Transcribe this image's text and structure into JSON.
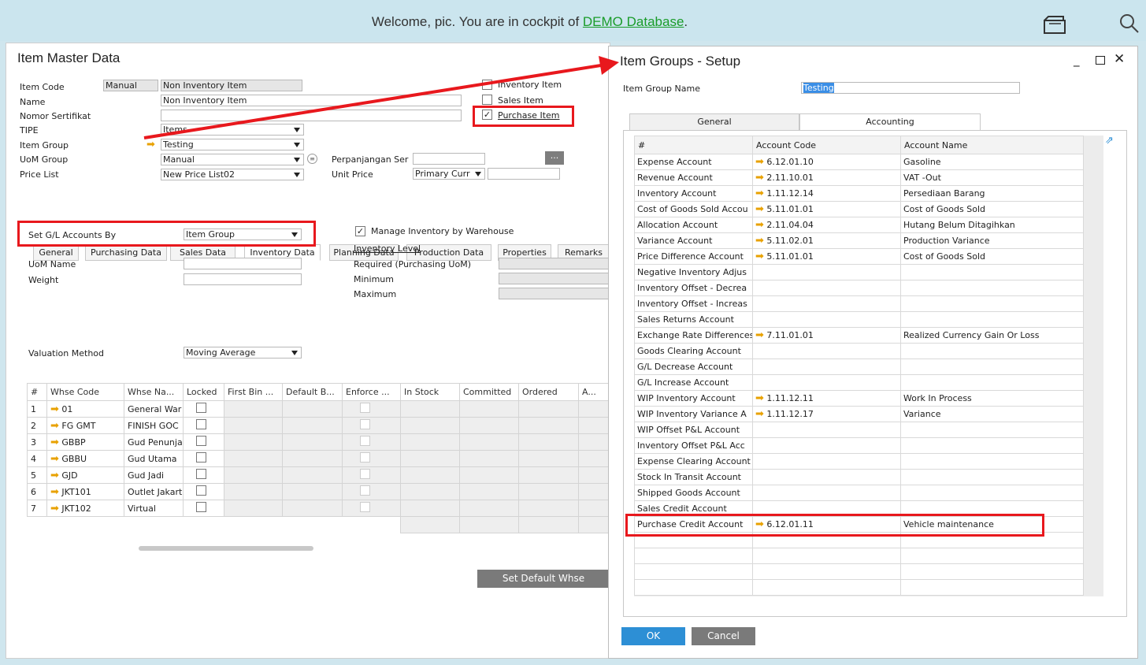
{
  "topbar": {
    "welcome_prefix": "Welcome, pic. You are in cockpit of ",
    "db_link": "DEMO Database",
    "suffix": "."
  },
  "imd": {
    "title": "Item Master Data",
    "labels": {
      "item_code": "Item Code",
      "name": "Name",
      "nomor": "Nomor Sertifikat",
      "tipe": "TIPE",
      "item_group": "Item Group",
      "uom_group": "UoM Group",
      "price_list": "Price List",
      "perpanjangan": "Perpanjangan Ser",
      "unit_price": "Unit Price"
    },
    "values": {
      "code_mode": "Manual",
      "item_code": "Non Inventory Item",
      "name": "Non Inventory Item",
      "nomor": "",
      "tipe": "Items",
      "item_group": "Testing",
      "uom_group": "Manual",
      "price_list": "New Price List02",
      "currency": "Primary Curr"
    },
    "checks": {
      "inventory": "Inventory Item",
      "sales": "Sales Item",
      "purchase": "Purchase Item"
    },
    "browse": "...",
    "tabs": [
      "General",
      "Purchasing Data",
      "Sales Data",
      "Inventory Data",
      "Planning Data",
      "Production Data",
      "Properties",
      "Remarks"
    ],
    "inv": {
      "gl_label": "Set G/L Accounts By",
      "gl_value": "Item Group",
      "manage": "Manage Inventory by Warehouse",
      "uom_name": "UoM Name",
      "weight": "Weight",
      "inv_level": "Inventory Level",
      "required": "Required (Purchasing UoM)",
      "minimum": "Minimum",
      "maximum": "Maximum",
      "valuation_label": "Valuation Method",
      "valuation": "Moving Average"
    },
    "wh_headers": [
      "#",
      "Whse Code",
      "Whse Na...",
      "Locked",
      "First Bin ...",
      "Default B...",
      "Enforce ...",
      "In Stock",
      "Committed",
      "Ordered",
      "A..."
    ],
    "wh_rows": [
      {
        "n": "1",
        "code": "01",
        "name": "General War"
      },
      {
        "n": "2",
        "code": "FG GMT",
        "name": "FINISH GOC"
      },
      {
        "n": "3",
        "code": "GBBP",
        "name": "Gud Penunja"
      },
      {
        "n": "4",
        "code": "GBBU",
        "name": "Gud Utama"
      },
      {
        "n": "5",
        "code": "GJD",
        "name": "Gud Jadi"
      },
      {
        "n": "6",
        "code": "JKT101",
        "name": "Outlet Jakart"
      },
      {
        "n": "7",
        "code": "JKT102",
        "name": "Virtual"
      }
    ],
    "set_default": "Set Default Whse"
  },
  "igs": {
    "title": "Item Groups - Setup",
    "name_label": "Item Group Name",
    "name_value": "Testing",
    "tabs": [
      "General",
      "Accounting"
    ],
    "headers": [
      "#",
      "Account Code",
      "Account Name"
    ],
    "rows": [
      {
        "acc": "Expense Account",
        "code": "6.12.01.10",
        "name": "Gasoline"
      },
      {
        "acc": "Revenue Account",
        "code": "2.11.10.01",
        "name": "VAT -Out"
      },
      {
        "acc": "Inventory Account",
        "code": "1.11.12.14",
        "name": "Persediaan Barang"
      },
      {
        "acc": "Cost of Goods Sold Accou",
        "code": "5.11.01.01",
        "name": "Cost of Goods Sold"
      },
      {
        "acc": "Allocation Account",
        "code": "2.11.04.04",
        "name": "Hutang Belum Ditagihkan"
      },
      {
        "acc": "Variance Account",
        "code": "5.11.02.01",
        "name": "Production Variance"
      },
      {
        "acc": "Price Difference Account",
        "code": "5.11.01.01",
        "name": "Cost of Goods Sold"
      },
      {
        "acc": "Negative Inventory Adjus",
        "code": "",
        "name": ""
      },
      {
        "acc": "Inventory Offset - Decrea",
        "code": "",
        "name": ""
      },
      {
        "acc": "Inventory Offset - Increas",
        "code": "",
        "name": ""
      },
      {
        "acc": "Sales Returns Account",
        "code": "",
        "name": ""
      },
      {
        "acc": "Exchange Rate Differences",
        "code": "7.11.01.01",
        "name": "Realized Currency Gain Or Loss"
      },
      {
        "acc": "Goods Clearing Account",
        "code": "",
        "name": ""
      },
      {
        "acc": "G/L Decrease Account",
        "code": "",
        "name": ""
      },
      {
        "acc": "G/L Increase Account",
        "code": "",
        "name": ""
      },
      {
        "acc": "WIP Inventory Account",
        "code": "1.11.12.11",
        "name": "Work In Process"
      },
      {
        "acc": "WIP Inventory Variance A",
        "code": "1.11.12.17",
        "name": "Variance"
      },
      {
        "acc": "WIP Offset P&L Account",
        "code": "",
        "name": ""
      },
      {
        "acc": "Inventory Offset P&L Acc",
        "code": "",
        "name": ""
      },
      {
        "acc": "Expense Clearing Account",
        "code": "",
        "name": ""
      },
      {
        "acc": "Stock In Transit Account",
        "code": "",
        "name": ""
      },
      {
        "acc": "Shipped Goods Account",
        "code": "",
        "name": ""
      },
      {
        "acc": "Sales Credit Account",
        "code": "",
        "name": ""
      },
      {
        "acc": "Purchase Credit Account",
        "code": "6.12.01.11",
        "name": "Vehicle maintenance"
      },
      {
        "acc": "",
        "code": "",
        "name": ""
      },
      {
        "acc": "",
        "code": "",
        "name": ""
      },
      {
        "acc": "",
        "code": "",
        "name": ""
      },
      {
        "acc": "",
        "code": "",
        "name": ""
      }
    ],
    "ok": "OK",
    "cancel": "Cancel"
  },
  "colors": {
    "red": "#e8181d",
    "ok_blue": "#2d8fd5",
    "cancel_grey": "#7a7a7a",
    "arrow": "#e8a100"
  }
}
